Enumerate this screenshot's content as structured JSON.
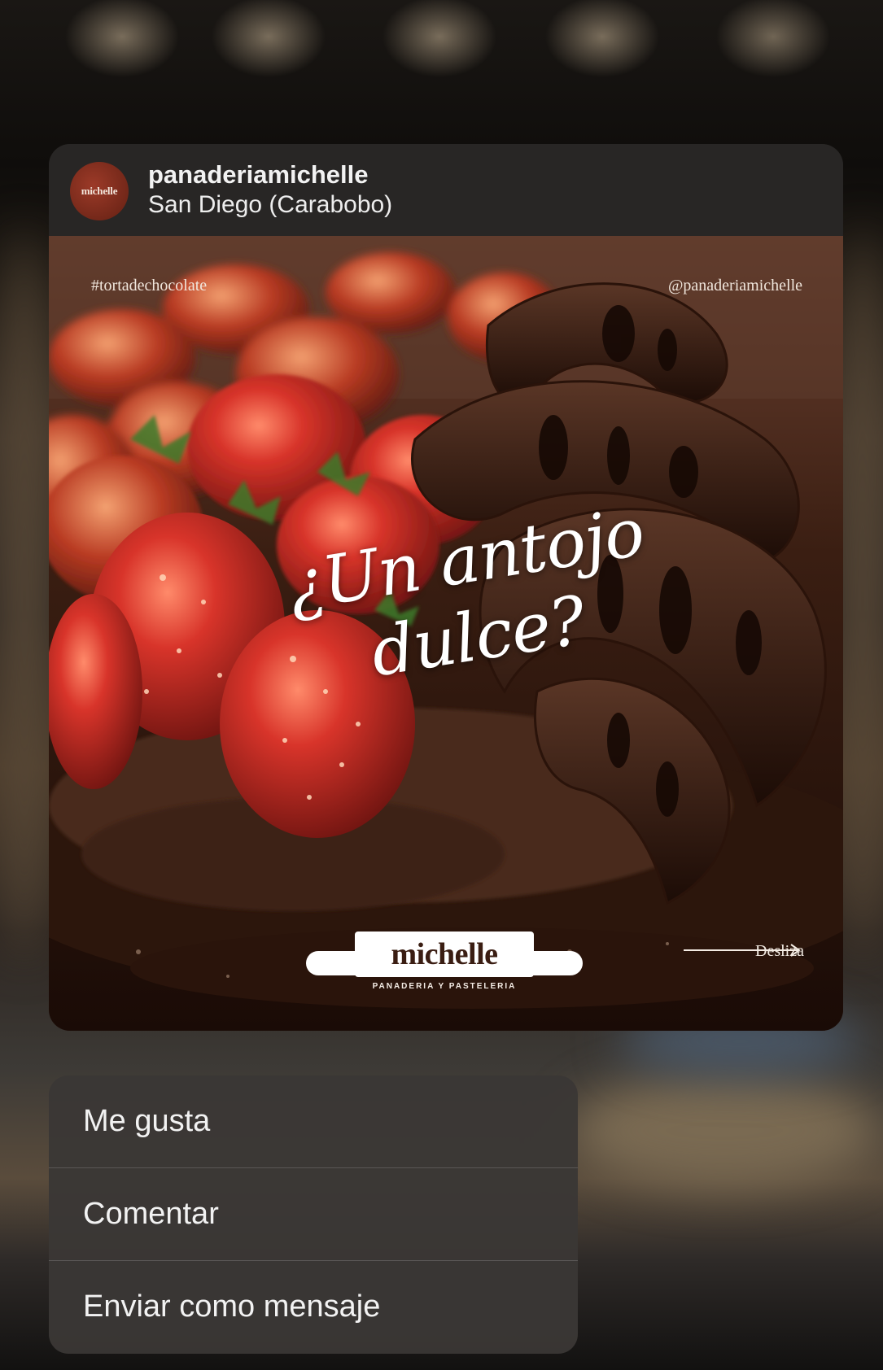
{
  "post": {
    "username": "panaderiamichelle",
    "location": "San Diego (Carabobo)",
    "avatar_text": "michelle"
  },
  "image": {
    "hashtag": "#tortadechocolate",
    "handle": "@panaderiamichelle",
    "headline_line1": "¿Un antojo",
    "headline_line2": "dulce?",
    "logo_word": "michelle",
    "logo_sub": "PANADERIA Y PASTELERIA",
    "swipe_label": "Desliza"
  },
  "menu": {
    "items": [
      {
        "label": "Me gusta"
      },
      {
        "label": "Comentar"
      },
      {
        "label": "Enviar como mensaje"
      }
    ]
  },
  "colors": {
    "card_header": "#282625",
    "menu_bg": "#3a3735",
    "text": "#f2f2f2",
    "avatar": "#8c3020"
  }
}
